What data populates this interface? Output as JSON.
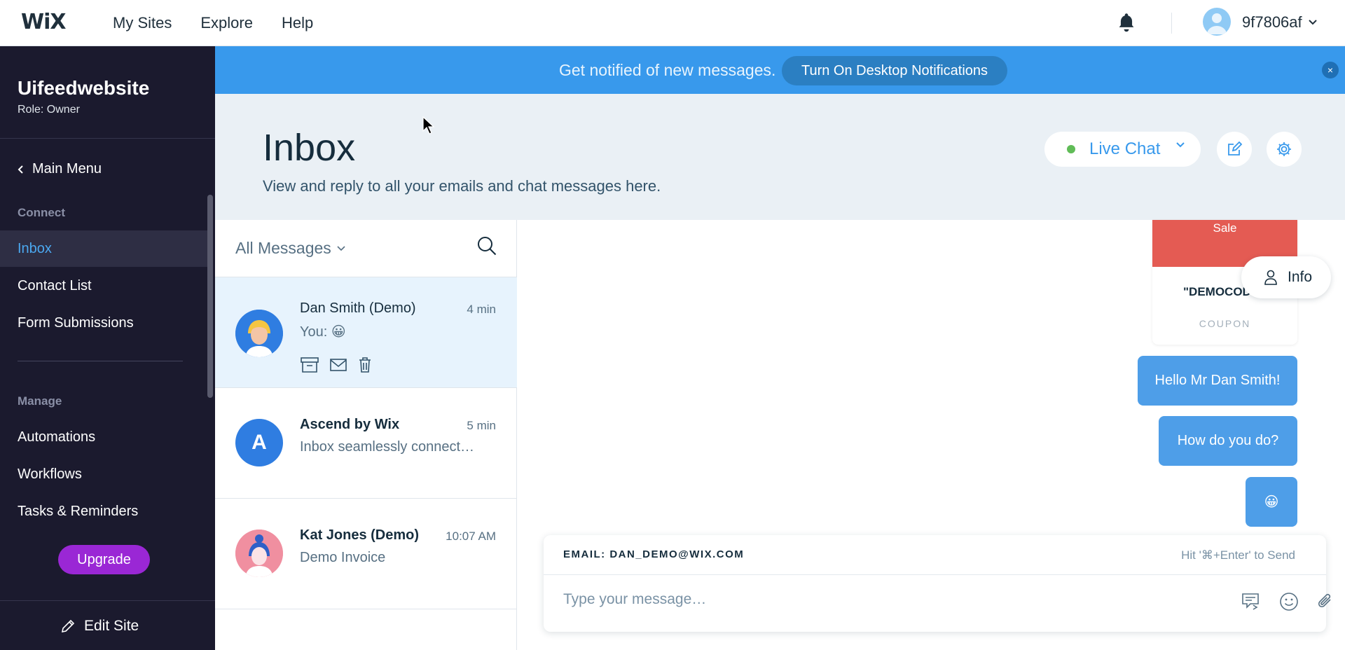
{
  "topbar": {
    "logo": "WiX",
    "nav": [
      "My Sites",
      "Explore",
      "Help"
    ],
    "account": "9f7806af"
  },
  "sidebar": {
    "site_name": "Uifeedwebsite",
    "role": "Role: Owner",
    "main_menu": "Main Menu",
    "section_connect": "Connect",
    "connect_items": [
      "Inbox",
      "Contact List",
      "Form Submissions"
    ],
    "section_manage": "Manage",
    "manage_items": [
      "Automations",
      "Workflows",
      "Tasks & Reminders"
    ],
    "upgrade": "Upgrade",
    "edit_site": "Edit Site"
  },
  "banner": {
    "text": "Get notified of new messages.",
    "button": "Turn On Desktop Notifications",
    "close": "×"
  },
  "header": {
    "title": "Inbox",
    "subtitle": "View and reply to all your emails and chat messages here.",
    "live_chat": "Live Chat",
    "live_chat_status_color": "#60bc57"
  },
  "list": {
    "filter": "All Messages",
    "conversations": [
      {
        "name": "Dan Smith (Demo)",
        "time": "4 min",
        "preview": "You: 😀",
        "selected": true
      },
      {
        "name": "Ascend by Wix",
        "time": "5 min",
        "preview": "Inbox seamlessly connect…",
        "avatar_letter": "A"
      },
      {
        "name": "Kat Jones (Demo)",
        "time": "10:07 AM",
        "preview": "Demo Invoice"
      }
    ]
  },
  "chat": {
    "coupon_top": "Sale",
    "coupon_code": "\"DEMOCODE\"",
    "coupon_label": "COUPON",
    "info": "Info",
    "messages": [
      "Hello Mr Dan Smith!",
      "How do you do?",
      "😀"
    ],
    "email_label": "EMAIL: DAN_DEMO@WIX.COM",
    "send_hint": "Hit '⌘+Enter' to Send",
    "placeholder": "Type your message…"
  },
  "colors": {
    "accent": "#3899ec",
    "sidebar_bg": "#1b1a2e",
    "upgrade": "#9a27d5",
    "bubble": "#4e9ee8"
  }
}
